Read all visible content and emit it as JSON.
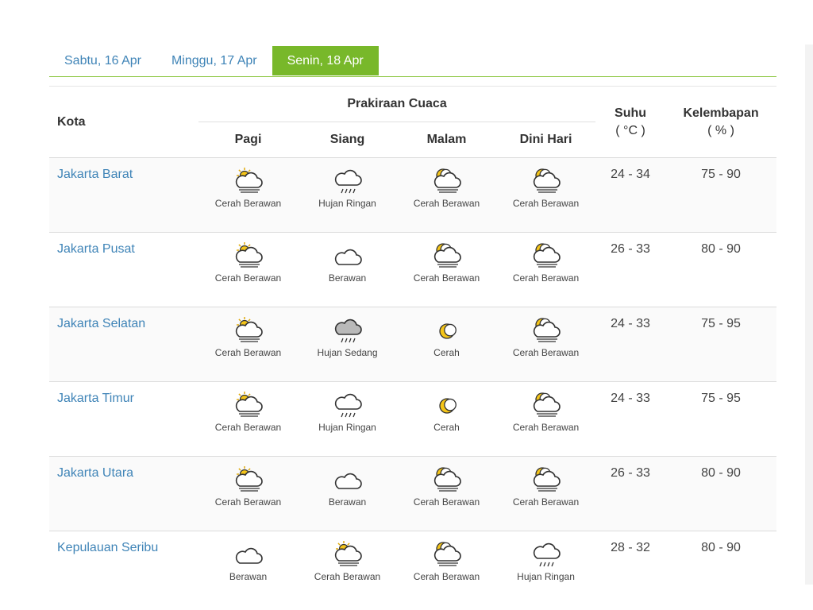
{
  "tabs": [
    {
      "label": "Sabtu, 16 Apr",
      "active": false
    },
    {
      "label": "Minggu, 17 Apr",
      "active": false
    },
    {
      "label": "Senin, 18 Apr",
      "active": true
    }
  ],
  "table": {
    "headers": {
      "kota": "Kota",
      "forecast_group": "Prakiraan Cuaca",
      "pagi": "Pagi",
      "siang": "Siang",
      "malam": "Malam",
      "dini_hari": "Dini Hari",
      "suhu": "Suhu",
      "suhu_unit": "( °C )",
      "kelembapan": "Kelembapan",
      "kelembapan_unit": "( % )"
    },
    "rows": [
      {
        "city": "Jakarta Barat",
        "pagi": {
          "label": "Cerah Berawan",
          "icon": "sun-cloud-icon"
        },
        "siang": {
          "label": "Hujan Ringan",
          "icon": "light-rain-icon"
        },
        "malam": {
          "label": "Cerah Berawan",
          "icon": "moon-cloud-icon"
        },
        "dini_hari": {
          "label": "Cerah Berawan",
          "icon": "moon-cloud-icon"
        },
        "suhu": "24 - 34",
        "kelembapan": "75 - 90"
      },
      {
        "city": "Jakarta Pusat",
        "pagi": {
          "label": "Cerah Berawan",
          "icon": "sun-cloud-icon"
        },
        "siang": {
          "label": "Berawan",
          "icon": "cloud-icon"
        },
        "malam": {
          "label": "Cerah Berawan",
          "icon": "moon-cloud-icon"
        },
        "dini_hari": {
          "label": "Cerah Berawan",
          "icon": "moon-cloud-icon"
        },
        "suhu": "26 - 33",
        "kelembapan": "80 - 90"
      },
      {
        "city": "Jakarta Selatan",
        "pagi": {
          "label": "Cerah Berawan",
          "icon": "sun-cloud-icon"
        },
        "siang": {
          "label": "Hujan Sedang",
          "icon": "moderate-rain-icon"
        },
        "malam": {
          "label": "Cerah",
          "icon": "moon-icon"
        },
        "dini_hari": {
          "label": "Cerah Berawan",
          "icon": "moon-cloud-icon"
        },
        "suhu": "24 - 33",
        "kelembapan": "75 - 95"
      },
      {
        "city": "Jakarta Timur",
        "pagi": {
          "label": "Cerah Berawan",
          "icon": "sun-cloud-icon"
        },
        "siang": {
          "label": "Hujan Ringan",
          "icon": "light-rain-icon"
        },
        "malam": {
          "label": "Cerah",
          "icon": "moon-icon"
        },
        "dini_hari": {
          "label": "Cerah Berawan",
          "icon": "moon-cloud-icon"
        },
        "suhu": "24 - 33",
        "kelembapan": "75 - 95"
      },
      {
        "city": "Jakarta Utara",
        "pagi": {
          "label": "Cerah Berawan",
          "icon": "sun-cloud-icon"
        },
        "siang": {
          "label": "Berawan",
          "icon": "cloud-icon"
        },
        "malam": {
          "label": "Cerah Berawan",
          "icon": "moon-cloud-icon"
        },
        "dini_hari": {
          "label": "Cerah Berawan",
          "icon": "moon-cloud-icon"
        },
        "suhu": "26 - 33",
        "kelembapan": "80 - 90"
      },
      {
        "city": "Kepulauan Seribu",
        "pagi": {
          "label": "Berawan",
          "icon": "cloud-icon"
        },
        "siang": {
          "label": "Cerah Berawan",
          "icon": "sun-cloud-icon"
        },
        "malam": {
          "label": "Cerah Berawan",
          "icon": "moon-cloud-icon"
        },
        "dini_hari": {
          "label": "Hujan Ringan",
          "icon": "light-rain-icon"
        },
        "suhu": "28 - 32",
        "kelembapan": "80 - 90"
      }
    ]
  },
  "colors": {
    "accent_green": "#78b82a",
    "tab_border": "#8cc63f",
    "link_blue": "#3f84b7",
    "sun_yellow": "#f5c518"
  }
}
